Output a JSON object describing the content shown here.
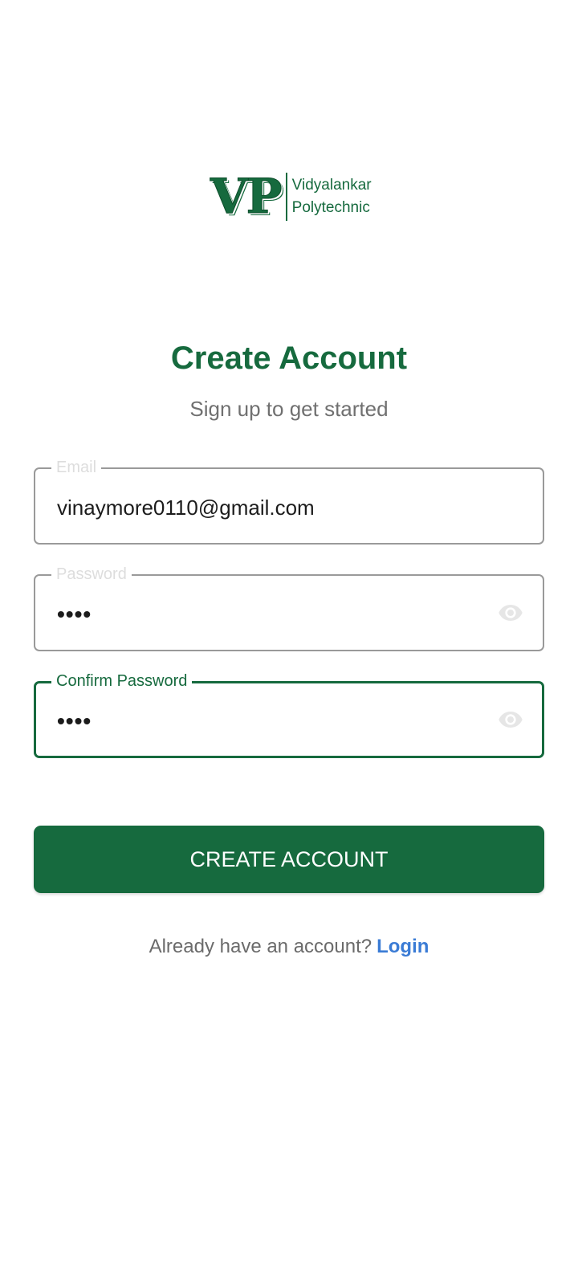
{
  "brand": {
    "mark": "VP",
    "line1": "Vidyalankar",
    "line2": "Polytechnic",
    "color": "#166a3e"
  },
  "heading": {
    "title": "Create Account",
    "subtitle": "Sign up to get started"
  },
  "form": {
    "email": {
      "label": "Email",
      "value": "vinaymore0110@gmail.com"
    },
    "password": {
      "label": "Password",
      "value": "••••",
      "toggle_icon": "eye-icon"
    },
    "confirm_password": {
      "label": "Confirm Password",
      "value": "••••",
      "toggle_icon": "eye-icon",
      "focused": true
    },
    "submit_label": "CREATE ACCOUNT"
  },
  "footer": {
    "prompt": "Already have an account?",
    "link_label": "Login",
    "link_color": "#3a7bd5"
  }
}
